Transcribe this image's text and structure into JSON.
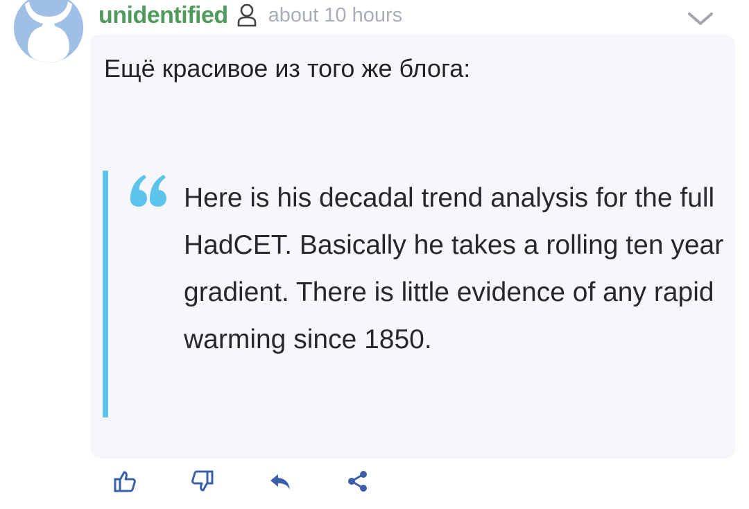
{
  "comment": {
    "username": "unidentified",
    "time": "about 10 hours",
    "text": "Ещё красивое из того же блога:",
    "quote": "Here is his decadal trend analysis for the full HadCET. Basically he takes a rolling ten year gradient. There is little evidence of any rapid warming since 1850."
  },
  "icons": {
    "user": "user-icon",
    "menu": "chevron-down-icon",
    "like": "thumbs-up-icon",
    "dislike": "thumbs-down-icon",
    "reply": "reply-icon",
    "share": "share-icon"
  },
  "colors": {
    "username": "#4f9a5c",
    "time": "#a9adb6",
    "bubble": "#f6f7fc",
    "quote_accent": "#5cc3ea",
    "action_icons": "#3b5fa8",
    "avatar": "#9fbfe6"
  }
}
